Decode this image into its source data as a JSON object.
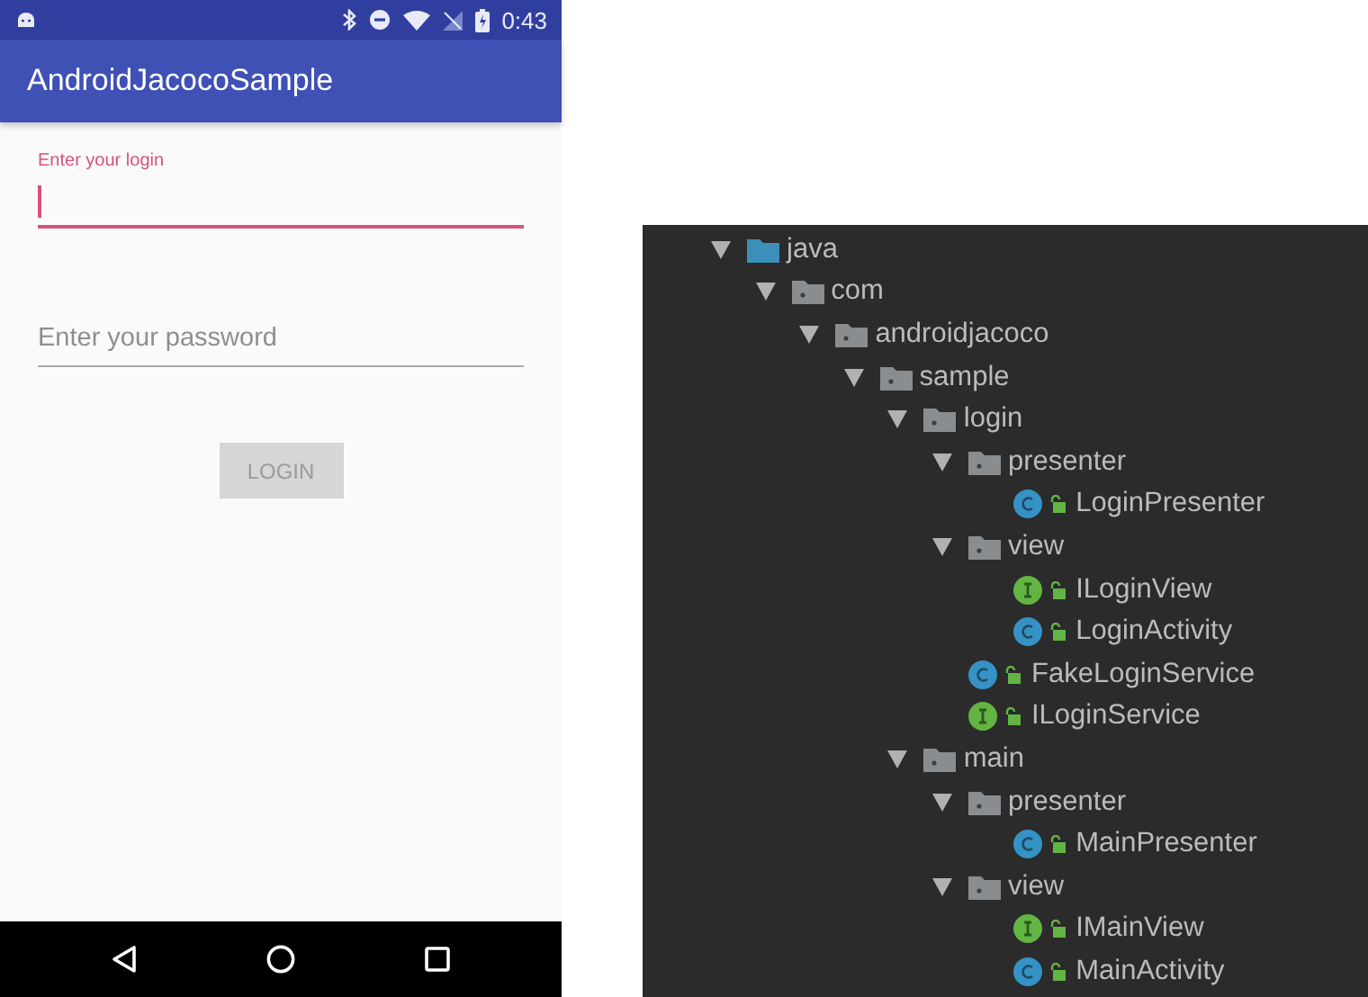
{
  "status_bar": {
    "time": "0:43"
  },
  "app_bar": {
    "title": "AndroidJacocoSample"
  },
  "login_field": {
    "label": "Enter your login",
    "focused": true
  },
  "password_field": {
    "placeholder": "Enter your password",
    "focused": false
  },
  "login_button": {
    "label": "LOGIN",
    "disabled": true
  },
  "project_tree": [
    {
      "kind": "source-folder",
      "name": "java",
      "expanded": true,
      "children": [
        {
          "kind": "package",
          "name": "com",
          "expanded": true,
          "children": [
            {
              "kind": "package",
              "name": "androidjacoco",
              "expanded": true,
              "children": [
                {
                  "kind": "package",
                  "name": "sample",
                  "expanded": true,
                  "children": [
                    {
                      "kind": "package",
                      "name": "login",
                      "expanded": true,
                      "children": [
                        {
                          "kind": "package",
                          "name": "presenter",
                          "expanded": true,
                          "children": [
                            {
                              "kind": "class",
                              "name": "LoginPresenter"
                            }
                          ]
                        },
                        {
                          "kind": "package",
                          "name": "view",
                          "expanded": true,
                          "children": [
                            {
                              "kind": "interface",
                              "name": "ILoginView"
                            },
                            {
                              "kind": "class",
                              "name": "LoginActivity"
                            }
                          ]
                        },
                        {
                          "kind": "class",
                          "name": "FakeLoginService"
                        },
                        {
                          "kind": "interface",
                          "name": "ILoginService"
                        }
                      ]
                    },
                    {
                      "kind": "package",
                      "name": "main",
                      "expanded": true,
                      "children": [
                        {
                          "kind": "package",
                          "name": "presenter",
                          "expanded": true,
                          "children": [
                            {
                              "kind": "class",
                              "name": "MainPresenter"
                            }
                          ]
                        },
                        {
                          "kind": "package",
                          "name": "view",
                          "expanded": true,
                          "children": [
                            {
                              "kind": "interface",
                              "name": "IMainView"
                            },
                            {
                              "kind": "class",
                              "name": "MainActivity"
                            }
                          ]
                        }
                      ]
                    }
                  ]
                }
              ]
            }
          ]
        }
      ]
    }
  ]
}
